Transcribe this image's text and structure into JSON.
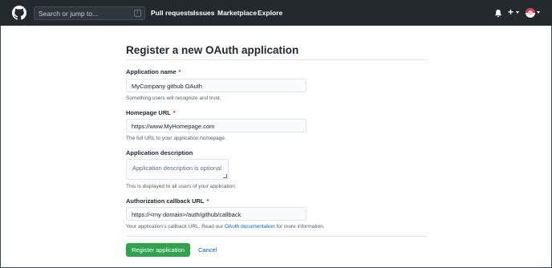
{
  "header": {
    "search_placeholder": "Search or jump to...",
    "search_shortcut": "/",
    "nav": [
      "Pull requests",
      "Issues",
      "Marketplace",
      "Explore"
    ]
  },
  "form": {
    "title": "Register a new OAuth application",
    "required_marker": "*",
    "app_name": {
      "label": "Application name",
      "value": "MyCompany github OAuth",
      "help": "Something users will recognize and trust."
    },
    "homepage": {
      "label": "Homepage URL",
      "value": "https://www.MyHomepage.com",
      "help": "The full URL to your application homepage."
    },
    "description": {
      "label": "Application description",
      "placeholder": "Application description is optional",
      "help": "This is displayed to all users of your application."
    },
    "callback": {
      "label": "Authorization callback URL",
      "value": "https://<my domain>/auth/github/callback",
      "help_prefix": "Your application’s callback URL. Read our ",
      "help_link": "OAuth documentation",
      "help_suffix": " for more information."
    },
    "submit_label": "Register application",
    "cancel_label": "Cancel"
  },
  "colors": {
    "header_bg": "#24292e",
    "primary_button": "#2ea44f",
    "link": "#0366d6",
    "required": "#cb2431"
  },
  "icons": [
    "github-logo-icon",
    "bell-icon",
    "plus-icon",
    "chevron-down-icon",
    "avatar"
  ]
}
